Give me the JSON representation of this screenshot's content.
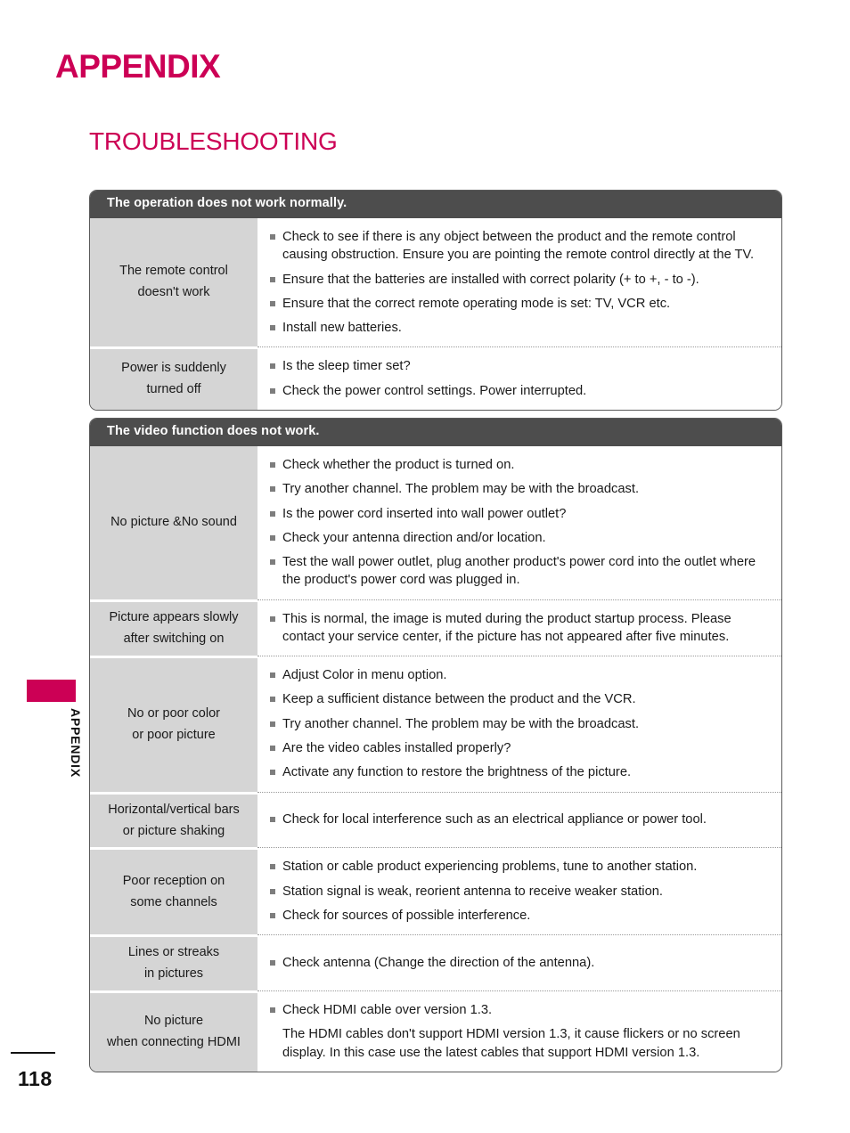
{
  "page": {
    "title": "APPENDIX",
    "section_title": "TROUBLESHOOTING",
    "side_label": "APPENDIX",
    "page_number": "118",
    "accent_color": "#cc0055",
    "header_bar_color": "#4d4d4d",
    "label_cell_color": "#d5d5d5"
  },
  "tables": [
    {
      "header": "The operation does not work normally.",
      "rows": [
        {
          "label": "The remote control\ndoesn't work",
          "label_line1": "The remote control",
          "label_line2": "doesn't work",
          "items": [
            "Check to see if there is any object between the product and the remote control causing obstruction. Ensure you are pointing the remote control directly at the TV.",
            "Ensure that the batteries are installed with correct polarity (+ to +, - to -).",
            "Ensure that the correct remote operating mode is set: TV, VCR etc.",
            "Install new batteries."
          ]
        },
        {
          "label_line1": "Power is suddenly",
          "label_line2": "turned off",
          "items": [
            "Is the sleep timer set?",
            "Check the power control settings. Power interrupted."
          ]
        }
      ]
    },
    {
      "header": "The video function does not work.",
      "rows": [
        {
          "label_line1": "No picture &No sound",
          "label_line2": "",
          "items": [
            "Check whether the product is turned on.",
            "Try another channel. The problem may be with the broadcast.",
            "Is the power cord inserted into wall power outlet?",
            "Check your antenna direction and/or location.",
            "Test the wall power outlet, plug another product's power cord into the outlet where the product's power cord was plugged in."
          ]
        },
        {
          "label_line1": "Picture appears slowly",
          "label_line2": "after switching on",
          "items": [
            "This is normal, the image is muted during the product startup process. Please contact your service center, if the picture has not appeared after five minutes."
          ]
        },
        {
          "label_line1": "No or poor color",
          "label_line2": "or poor picture",
          "items": [
            "Adjust Color in menu option.",
            "Keep a sufficient distance between the product and the VCR.",
            "Try another channel. The problem may be with the broadcast.",
            "Are the video cables installed properly?",
            "Activate any function to restore the brightness of the picture."
          ]
        },
        {
          "label_line1": "Horizontal/vertical bars",
          "label_line2": "or picture shaking",
          "items": [
            "Check for local interference such as an electrical appliance or power tool."
          ]
        },
        {
          "label_line1": "Poor reception on",
          "label_line2": "some channels",
          "items": [
            "Station or cable product experiencing problems, tune to another station.",
            "Station signal is weak, reorient antenna to receive weaker station.",
            "Check for sources of possible interference."
          ]
        },
        {
          "label_line1": "Lines or streaks",
          "label_line2": "in pictures",
          "items": [
            "Check antenna (Change the direction of the antenna)."
          ]
        },
        {
          "label_line1": "No picture",
          "label_line2": "when connecting HDMI",
          "items": [
            "Check HDMI cable over version 1.3."
          ],
          "plain_items": [
            "The HDMI cables don't support HDMI version 1.3, it cause flickers or no screen display. In this case use the latest cables that support HDMI version 1.3."
          ]
        }
      ]
    }
  ]
}
